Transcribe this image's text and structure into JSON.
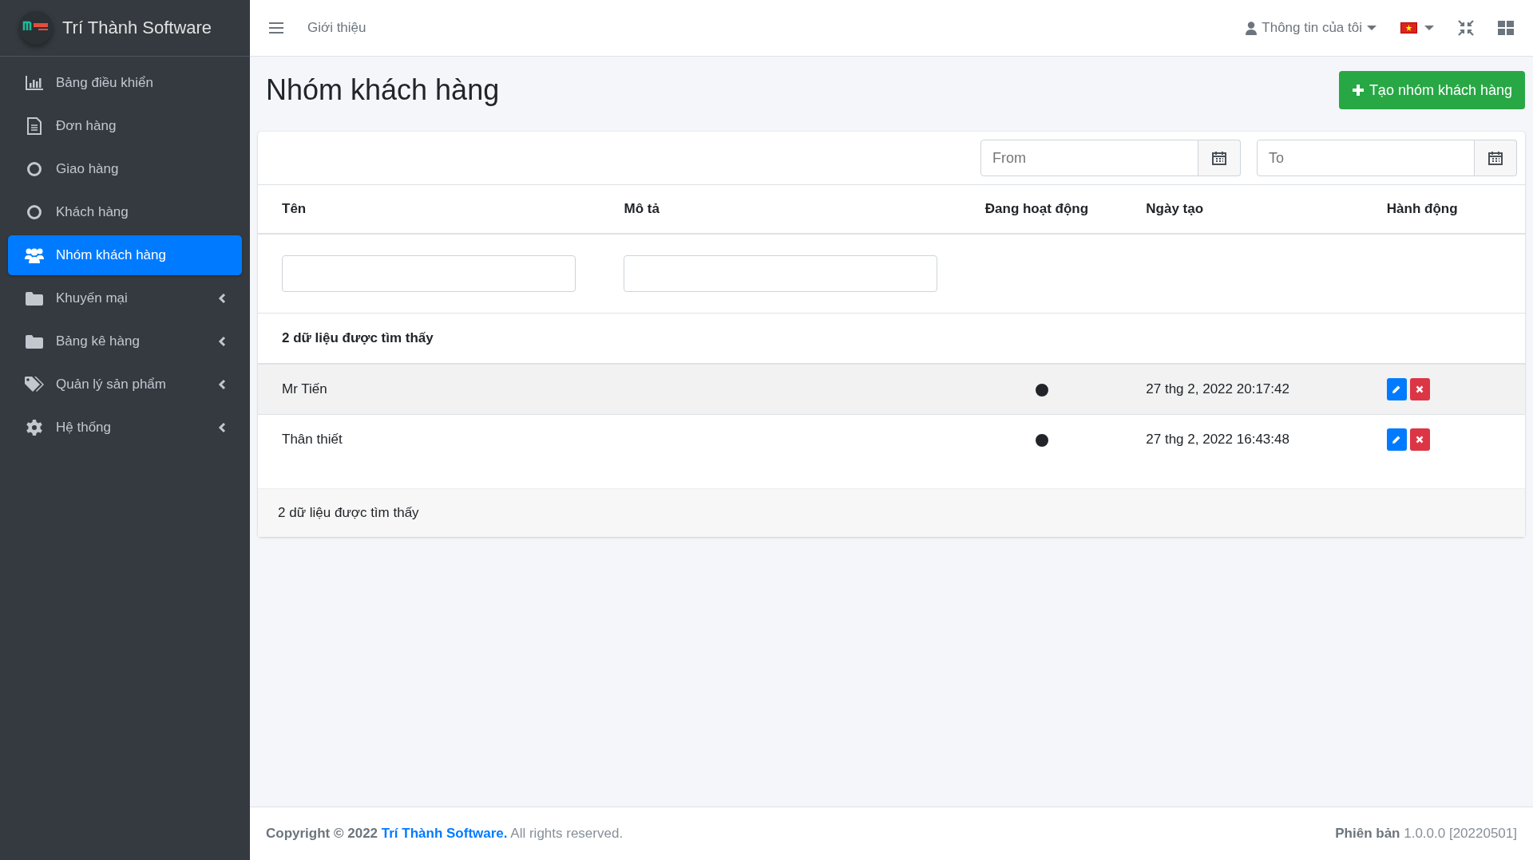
{
  "brand": {
    "title": "Trí Thành Software"
  },
  "sidebar": {
    "items": [
      {
        "label": "Bảng điều khiển",
        "selected": false,
        "submenu": false
      },
      {
        "label": "Đơn hàng",
        "selected": false,
        "submenu": false
      },
      {
        "label": "Giao hàng",
        "selected": false,
        "submenu": false
      },
      {
        "label": "Khách hàng",
        "selected": false,
        "submenu": false
      },
      {
        "label": "Nhóm khách hàng",
        "selected": true,
        "submenu": false
      },
      {
        "label": "Khuyến mại",
        "selected": false,
        "submenu": true
      },
      {
        "label": "Bảng kê hàng",
        "selected": false,
        "submenu": true
      },
      {
        "label": "Quản lý sản phẩm",
        "selected": false,
        "submenu": true
      },
      {
        "label": "Hệ thống",
        "selected": false,
        "submenu": true
      }
    ]
  },
  "topbar": {
    "nav_link": "Giới thiệu",
    "user_menu": "Thông tin của tôi"
  },
  "page": {
    "title": "Nhóm khách hàng",
    "create_button": "Tạo nhóm khách hàng"
  },
  "date_filter": {
    "from": {
      "placeholder": "From"
    },
    "to": {
      "placeholder": "To"
    }
  },
  "table": {
    "columns": [
      "Tên",
      "Mô tả",
      "Đang hoạt động",
      "Ngày tạo",
      "Hành động"
    ],
    "summary_top": "2 dữ liệu được tìm thấy",
    "rows": [
      {
        "name": "Mr Tiến",
        "active": true,
        "created": "27 thg 2, 2022 20:17:42",
        "selected": true
      },
      {
        "name": "Thân thiết",
        "active": true,
        "created": "27 thg 2, 2022 16:43:48",
        "selected": false
      }
    ],
    "summary_bottom": "2 dữ liệu được tìm thấy"
  },
  "footer": {
    "prefix": "Copyright © 2022",
    "link": "Trí Thành Software.",
    "suffix": "All rights reserved.",
    "version_label": "Phiên bản",
    "version": "1.0.0.0 [20220501]"
  }
}
